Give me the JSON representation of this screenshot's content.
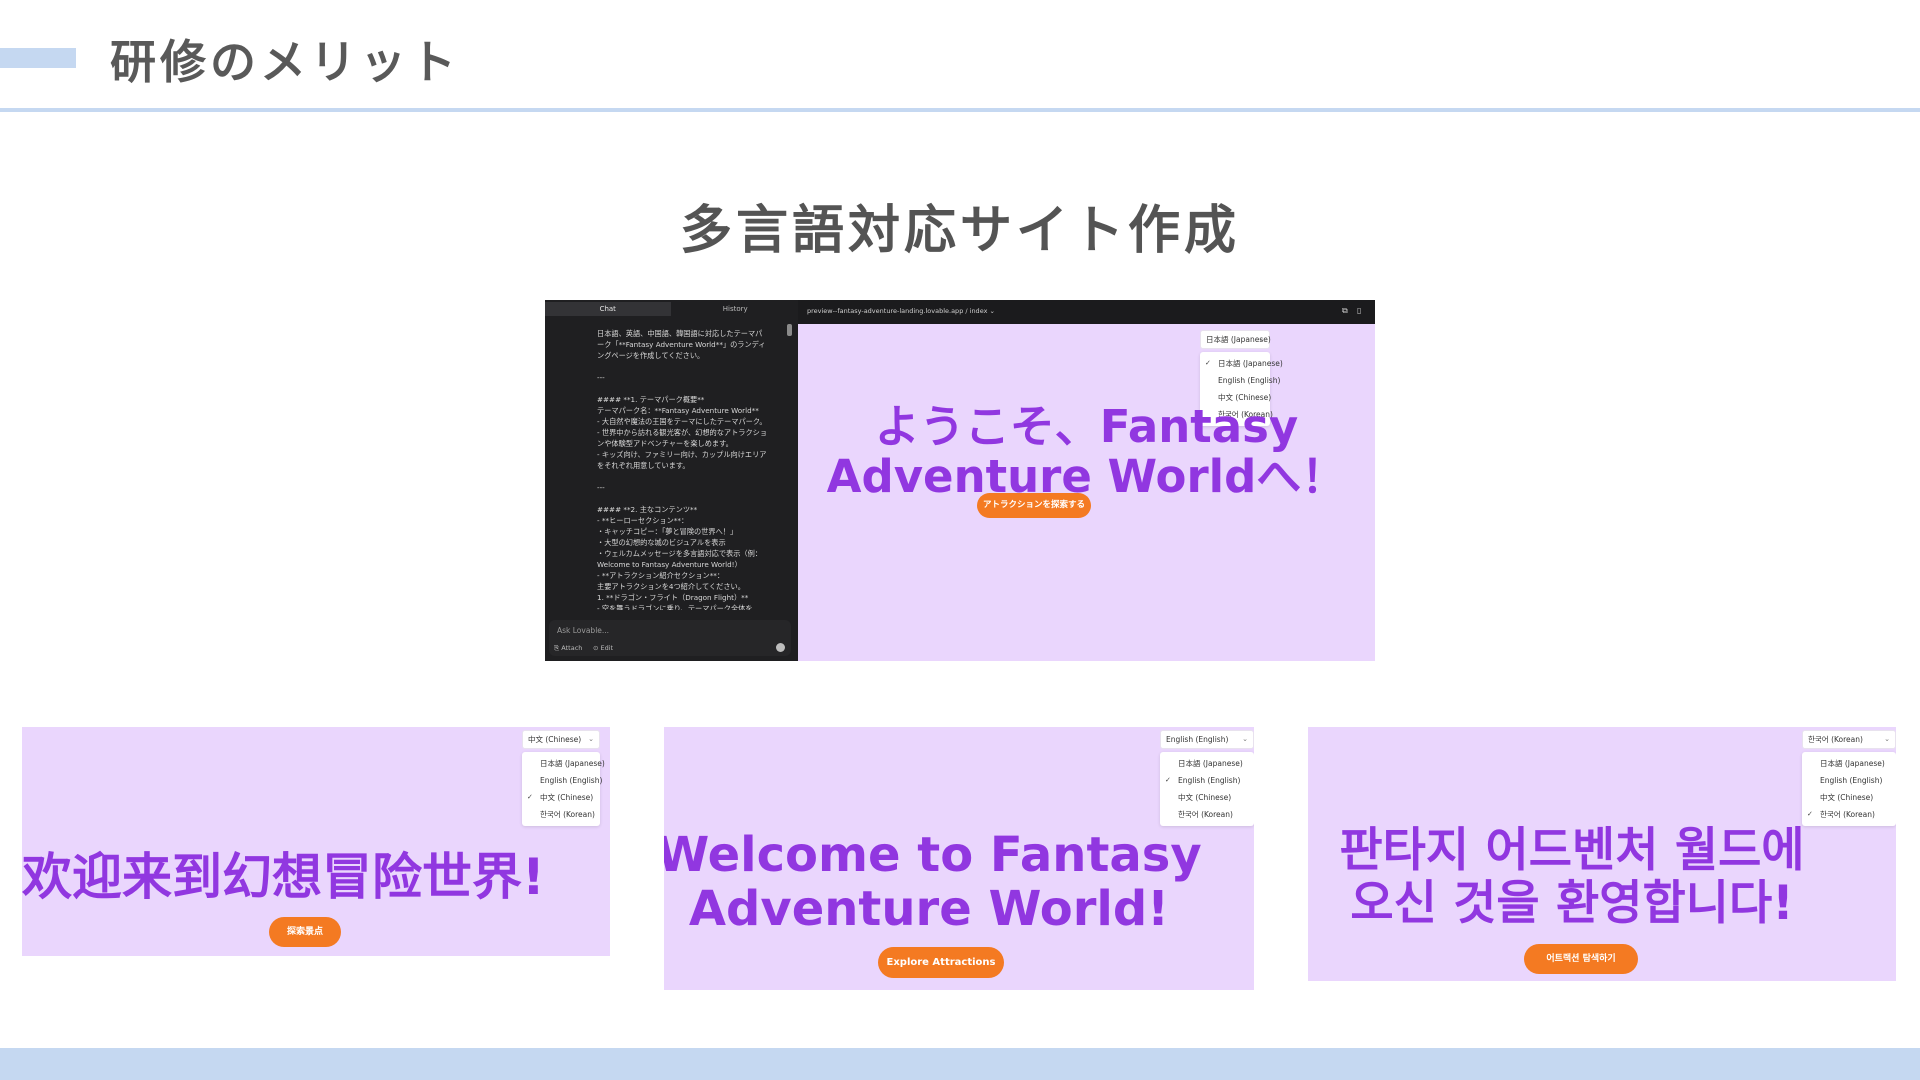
{
  "slide": {
    "title": "研修のメリット",
    "subtitle": "多言語対応サイト作成"
  },
  "editor": {
    "tabs": [
      "Chat",
      "History"
    ],
    "chat_lines": [
      "日本語、英語、中国語、韓国語に対応したテーマパ",
      "ーク「**Fantasy Adventure World**」のランディ",
      "ングページを作成してください。",
      "",
      "---",
      "",
      "#### **1. テーマパーク概要**",
      "テーマパーク名：**Fantasy Adventure World**",
      "- 大自然や魔法の王国をテーマにしたテーマパーク。",
      "- 世界中から訪れる観光客が、幻想的なアトラクショ",
      "ンや体験型アドベンチャーを楽しめます。",
      "- キッズ向け、ファミリー向け、カップル向けエリア",
      "をそれぞれ用意しています。",
      "",
      "---",
      "",
      "#### **2. 主なコンテンツ**",
      "- **ヒーローセクション**：",
      "  ・キャッチコピー：「夢と冒険の世界へ！」",
      "  ・大型の幻想的な城のビジュアルを表示",
      "  ・ウェルカムメッセージを多言語対応で表示（例：",
      "Welcome to Fantasy Adventure World!）",
      "- **アトラクション紹介セクション**：",
      "  主要アトラクションを4つ紹介してください。",
      "  1. **ドラゴン・フライト（Dragon Flight）**",
      "    - 空を舞うドラゴンに乗り、テーマパーク全体を"
    ],
    "ask_placeholder": "Ask Lovable...",
    "attach_label": "Attach",
    "edit_label": "Edit",
    "url": "preview--fantasy-adventure-landing.lovable.app / index ⌄"
  },
  "colors": {
    "accent_bar": "#c5d8f1",
    "panel_bg": "#ead6fd",
    "hero_text": "#9137e0",
    "cta": "#f47a22"
  },
  "languages": [
    "日本語 (Japanese)",
    "English (English)",
    "中文 (Chinese)",
    "한국어 (Korean)"
  ],
  "previews": {
    "ja": {
      "selected": "日本語 (Japanese)",
      "checked_index": 0,
      "hero_line1": "ようこそ、Fantasy",
      "hero_line2": "Adventure Worldへ！",
      "cta": "アトラクションを探索する"
    },
    "zh": {
      "selected": "中文 (Chinese)",
      "checked_index": 2,
      "hero_line1": "欢迎来到幻想冒险世界!",
      "cta": "探索景点"
    },
    "en": {
      "selected": "English (English)",
      "checked_index": 1,
      "hero_line1": "Welcome to Fantasy",
      "hero_line2": "Adventure World!",
      "cta": "Explore Attractions"
    },
    "ko": {
      "selected": "한국어 (Korean)",
      "checked_index": 3,
      "hero_line1": "판타지 어드벤처 월드에",
      "hero_line2": "오신 것을 환영합니다!",
      "cta": "어트랙션 탐색하기"
    }
  }
}
